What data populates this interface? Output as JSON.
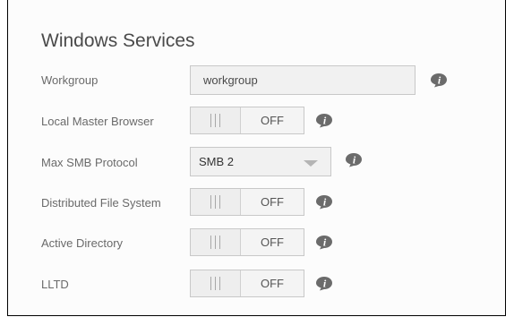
{
  "section": {
    "title": "Windows Services"
  },
  "workgroup": {
    "label": "Workgroup",
    "value": "workgroup"
  },
  "local_master_browser": {
    "label": "Local Master Browser",
    "state": "OFF"
  },
  "max_smb_protocol": {
    "label": "Max SMB Protocol",
    "selected": "SMB 2"
  },
  "distributed_file_system": {
    "label": "Distributed File System",
    "state": "OFF"
  },
  "active_directory": {
    "label": "Active Directory",
    "state": "OFF"
  },
  "lltd": {
    "label": "LLTD",
    "state": "OFF"
  },
  "icons": {
    "info": "info-icon",
    "grip": "grip-lines-icon",
    "dropdown": "chevron-down-icon"
  },
  "colors": {
    "icon_bubble": "#6b6b6b",
    "panel_border": "#000000",
    "field_background": "#f1f1f1"
  }
}
